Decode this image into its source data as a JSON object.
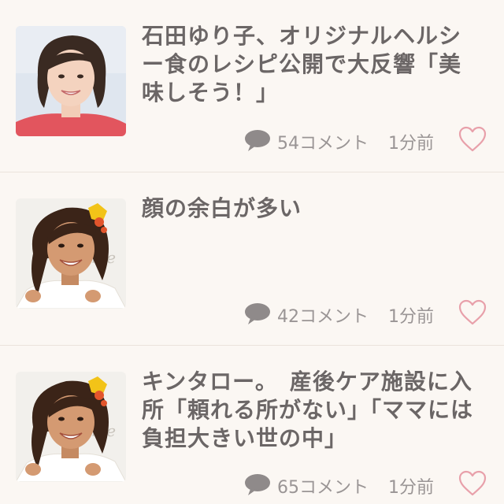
{
  "articles": [
    {
      "title": "石田ゆり子、オリジナルヘルシー食のレシピ公開で大反響「美味しそう！」",
      "comments": "54コメント",
      "time": "1分前",
      "thumbnail_icon": "portrait-photo-short-hair"
    },
    {
      "title": "顔の余白が多い",
      "comments": "42コメント",
      "time": "1分前",
      "thumbnail_icon": "portrait-photo-curly-hair"
    },
    {
      "title": "キンタロー。　産後ケア施設に入所「頼れる所がない」「ママには負担大きい世の中」",
      "comments": "65コメント",
      "time": "1分前",
      "thumbnail_icon": "portrait-photo-curly-hair"
    }
  ],
  "colors": {
    "background": "#fbf7f3",
    "title_text": "#6b6666",
    "meta_text": "#9a9595",
    "comment_icon": "#8f8a8a",
    "heart_outline": "#e8a0aa",
    "divider": "#ebe3dc"
  }
}
